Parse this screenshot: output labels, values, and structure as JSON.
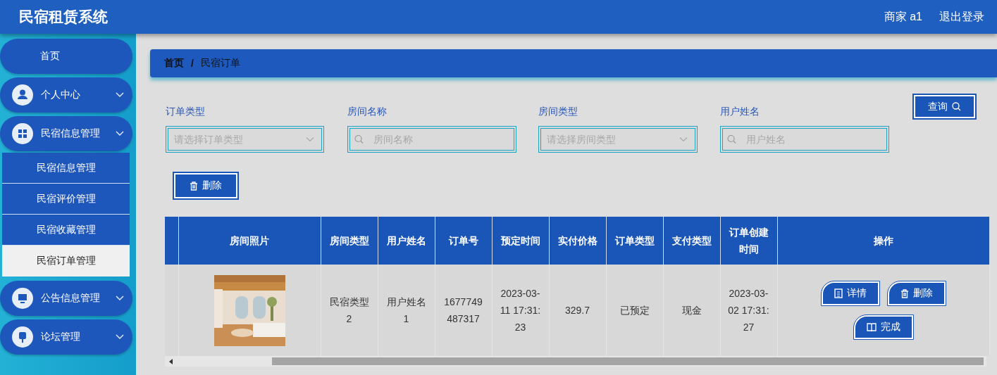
{
  "header": {
    "title": "民宿租赁系统",
    "user": "商家 a1",
    "logout": "退出登录"
  },
  "sidebar": {
    "items": [
      {
        "label": "首页",
        "kind": "link"
      },
      {
        "label": "个人中心",
        "kind": "submenu"
      },
      {
        "label": "民宿信息管理",
        "kind": "submenu",
        "children": [
          {
            "label": "民宿信息管理",
            "selected": false
          },
          {
            "label": "民宿评价管理",
            "selected": false
          },
          {
            "label": "民宿收藏管理",
            "selected": false
          },
          {
            "label": "民宿订单管理",
            "selected": true
          }
        ]
      },
      {
        "label": "公告信息管理",
        "kind": "submenu"
      },
      {
        "label": "论坛管理",
        "kind": "submenu"
      }
    ]
  },
  "breadcrumb": {
    "items": [
      "首页",
      "民宿订单"
    ],
    "separator": "/"
  },
  "filters": [
    {
      "label": "订单类型",
      "kind": "select",
      "placeholder": "请选择订单类型"
    },
    {
      "label": "房间名称",
      "kind": "search",
      "placeholder": "房间名称"
    },
    {
      "label": "房间类型",
      "kind": "select",
      "placeholder": "请选择房间类型"
    },
    {
      "label": "用户姓名",
      "kind": "search",
      "placeholder": "用户姓名"
    }
  ],
  "query_button": "查询",
  "delete_button": "删除",
  "table": {
    "columns": [
      "",
      "房间照片",
      "房间类型",
      "用户姓名",
      "订单号",
      "预定时间",
      "实付价格",
      "订单类型",
      "支付类型",
      "订单创建时间",
      "操作"
    ],
    "rows": [
      {
        "cells": [
          "",
          {
            "kind": "picture"
          },
          "民宿类型2",
          "用户姓名1",
          "1677749487317",
          "2023-03-11 17:31:23",
          "329.7",
          "已预定",
          "现金",
          "2023-03-02 17:31:27",
          {
            "kind": "actions",
            "buttons": [
              {
                "kind": "detail",
                "label": "详情"
              },
              {
                "kind": "delete",
                "label": "删除"
              },
              {
                "kind": "complete",
                "label": "完成"
              }
            ]
          }
        ]
      }
    ]
  }
}
